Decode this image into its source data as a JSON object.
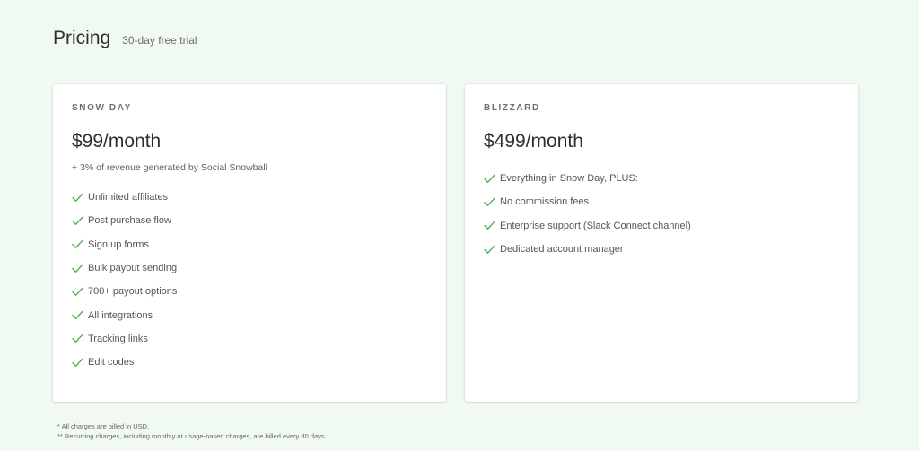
{
  "header": {
    "title": "Pricing",
    "subtitle": "30-day free trial"
  },
  "plans": [
    {
      "name": "SNOW DAY",
      "price": "$99/month",
      "note": "+ 3% of revenue generated by Social Snowball",
      "features": [
        "Unlimited affiliates",
        "Post purchase flow",
        "Sign up forms",
        "Bulk payout sending",
        "700+ payout options",
        "All integrations",
        "Tracking links",
        "Edit codes"
      ]
    },
    {
      "name": "BLIZZARD",
      "price": "$499/month",
      "features": [
        "Everything in Snow Day, PLUS:",
        "No commission fees",
        "Enterprise support (Slack Connect channel)",
        "Dedicated account manager"
      ]
    }
  ],
  "footnotes": [
    "* All charges are billed in USD.",
    "** Recurring charges, including monthly or usage-based charges, are billed every 30 days."
  ],
  "icons": {
    "feature_check": "check-icon"
  },
  "colors": {
    "background": "#f1faf1",
    "card": "#ffffff",
    "check": "#4caf50"
  }
}
